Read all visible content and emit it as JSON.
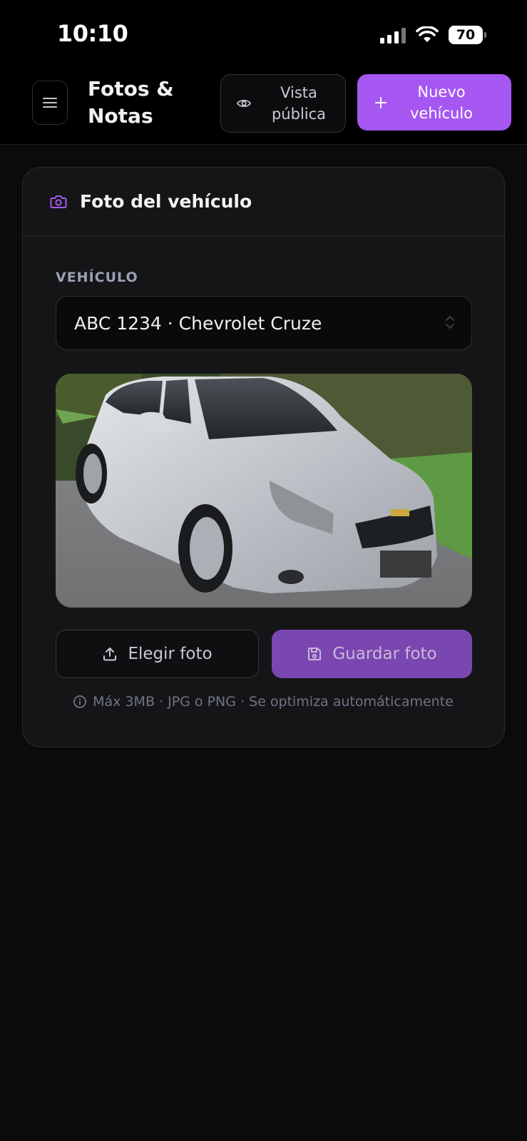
{
  "status_bar": {
    "time": "10:10",
    "battery": "70"
  },
  "header": {
    "title": "Fotos & Notas",
    "public_view_label": "Vista pública",
    "new_vehicle_label": "Nuevo vehículo"
  },
  "card": {
    "title": "Foto del vehículo",
    "vehicle_field_label": "VEHÍCULO",
    "vehicle_selected": "ABC 1234 · Chevrolet Cruze",
    "choose_photo_label": "Elegir foto",
    "save_photo_label": "Guardar foto",
    "hint": "Máx 3MB · JPG o PNG · Se optimiza automáticamente"
  },
  "colors": {
    "accent": "#a657f1",
    "accent_disabled": "#7a46b0",
    "background": "#0b0b0c"
  }
}
